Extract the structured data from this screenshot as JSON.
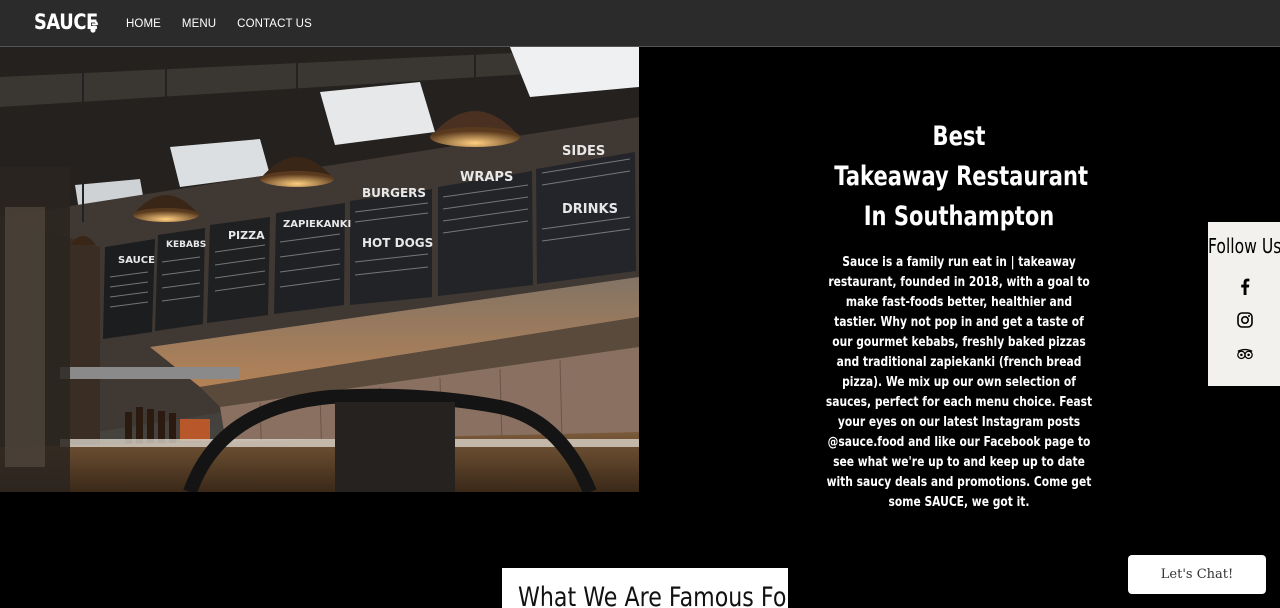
{
  "header": {
    "logo_text": "SAUCE",
    "nav": [
      "HOME",
      "MENU",
      "CONTACT US"
    ]
  },
  "hero": {
    "image_alt": "Takeaway restaurant interior with menu boards and pendant lights",
    "menu_boards": {
      "kebabs": "KEBABS",
      "pizza": "PIZZA",
      "zapiekanki": "ZAPIEKANKI",
      "burgers": "BURGERS",
      "hotdogs": "HOT DOGS",
      "wraps": "WRAPS",
      "sides": "SIDES",
      "drinks": "DRINKS",
      "sauce": "SAUCE"
    },
    "title_lines": [
      "Best",
      "Takeaway Restaurant",
      "In Southampton"
    ],
    "body": "Sauce is a family run eat in | takeaway restaurant, founded in 2018, with a goal to make fast-foods better, healthier and tastier. Why not pop in and get a taste of our gourmet kebabs, freshly baked pizzas and traditional zapiekanki (french bread pizza). We mix up our own selection of sauces, perfect for each menu choice. Feast your eyes on our latest Instagram posts @sauce.food and like our Facebook page to see what we're up to and keep up to date with saucy deals and promotions. Come get some SAUCE, we got it."
  },
  "follow": {
    "title": "Follow Us",
    "icons": [
      "facebook-icon",
      "instagram-icon",
      "tripadvisor-icon"
    ]
  },
  "famous": {
    "title": "What We Are Famous For"
  },
  "chat": {
    "label": "Let's Chat!"
  }
}
